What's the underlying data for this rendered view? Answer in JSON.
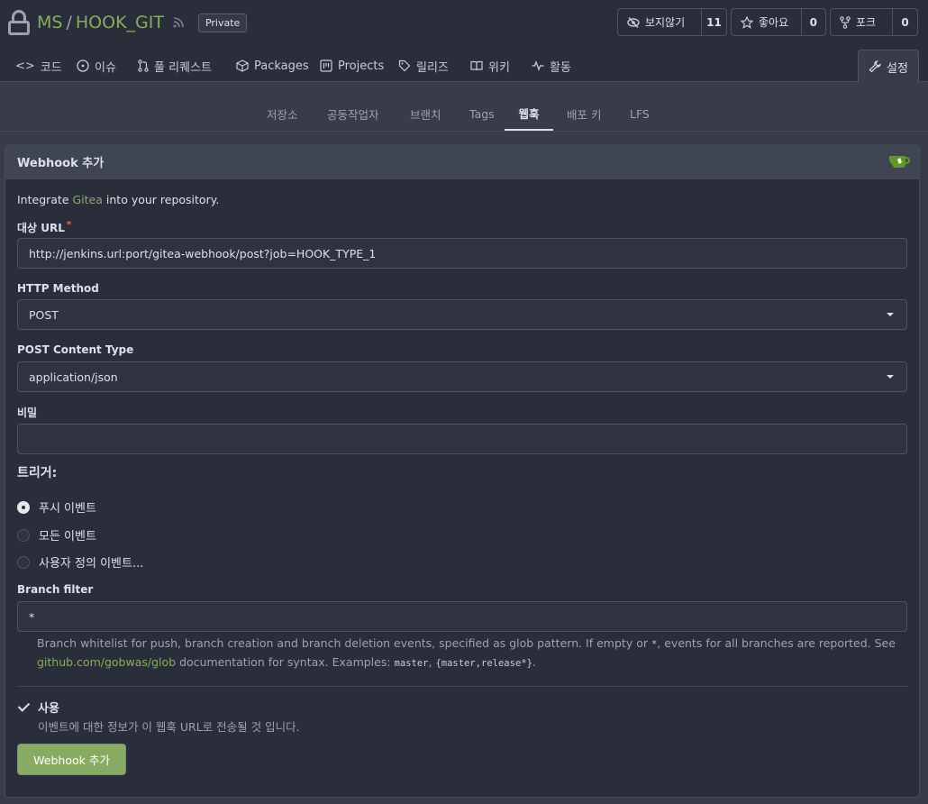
{
  "repo": {
    "owner": "MS",
    "separator": "/",
    "name": "HOOK_GIT",
    "visibility": "Private"
  },
  "actions": {
    "watch": {
      "label": "보지않기",
      "count": "11"
    },
    "star": {
      "label": "좋아요",
      "count": "0"
    },
    "fork": {
      "label": "포크",
      "count": "0"
    }
  },
  "tabs": [
    {
      "label": "코드",
      "icon": "code-icon"
    },
    {
      "label": "이슈",
      "icon": "issue-icon"
    },
    {
      "label": "풀 리퀘스트",
      "icon": "pull-request-icon"
    },
    {
      "label": "Packages",
      "icon": "package-icon"
    },
    {
      "label": "Projects",
      "icon": "project-icon"
    },
    {
      "label": "릴리즈",
      "icon": "tag-icon"
    },
    {
      "label": "위키",
      "icon": "book-icon"
    },
    {
      "label": "활동",
      "icon": "pulse-icon"
    }
  ],
  "settings_tab": {
    "label": "설정",
    "icon": "tools-icon"
  },
  "subtabs": [
    {
      "label": "저장소"
    },
    {
      "label": "공동작업자"
    },
    {
      "label": "브랜치"
    },
    {
      "label": "Tags"
    },
    {
      "label": "웹훅",
      "active": true
    },
    {
      "label": "배포 키"
    },
    {
      "label": "LFS"
    }
  ],
  "form": {
    "header": "Webhook 추가",
    "intro_before": "Integrate ",
    "intro_link": "Gitea",
    "intro_after": " into your repository.",
    "target_url_label": "대상 URL",
    "required_mark": "*",
    "target_url_value": "http://jenkins.url:port/gitea-webhook/post?job=HOOK_TYPE_1",
    "http_method_label": "HTTP Method",
    "http_method_value": "POST",
    "content_type_label": "POST Content Type",
    "content_type_value": "application/json",
    "secret_label": "비밀",
    "secret_value": "",
    "trigger_title": "트리거:",
    "triggers": [
      {
        "label": "푸시 이벤트",
        "checked": true
      },
      {
        "label": "모든 이벤트",
        "checked": false
      },
      {
        "label": "사용자 정의 이벤트...",
        "checked": false
      }
    ],
    "branch_filter_label": "Branch filter",
    "branch_filter_value": "*",
    "branch_help_1": "Branch whitelist for push, branch creation and branch deletion events, specified as glob pattern. If empty or ",
    "branch_help_star": "*",
    "branch_help_2": ", events for all branches are reported. See",
    "branch_help_link": "github.com/gobwas/glob",
    "branch_help_3": " documentation for syntax. Examples: ",
    "branch_help_ex1": "master",
    "branch_help_sep": ", ",
    "branch_help_ex2": "{master,release*}",
    "branch_help_end": ".",
    "active_label": "사용",
    "active_help": "이벤트에 대한 정보가 이 웹훅 URL로 전송될 것 입니다.",
    "active_checked": true,
    "submit_label": "Webhook 추가"
  },
  "colors": {
    "accent": "#87ab63",
    "background": "#383c4a",
    "panel": "#2a2e3a"
  }
}
